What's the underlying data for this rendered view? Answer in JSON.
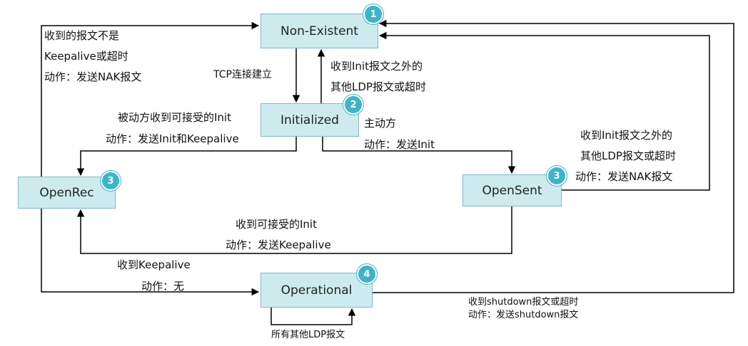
{
  "states": {
    "non_existent": {
      "label": "Non-Existent",
      "badge": "1"
    },
    "initialized": {
      "label": "Initialized",
      "badge": "2"
    },
    "openrec": {
      "label": "OpenRec",
      "badge": "3"
    },
    "opensent": {
      "label": "OpenSent",
      "badge": "3"
    },
    "operational": {
      "label": "Operational",
      "badge": "4"
    }
  },
  "transitions": {
    "left_top": {
      "line1": "收到的报文不是",
      "line2": "Keepalive或超时",
      "line3": "动作：发送NAK报文"
    },
    "tcp_connect": {
      "text": "TCP连接建立"
    },
    "init_fail": {
      "line1": "收到Init报文之外的",
      "line2": "其他LDP报文或超时"
    },
    "passive": {
      "line1": "被动方收到可接受的Init",
      "line2": "动作：发送Init和Keepalive"
    },
    "active": {
      "line1": "主动方",
      "line2": "动作：发送Init"
    },
    "opensent_fail": {
      "line1": "收到Init报文之外的",
      "line2": "其他LDP报文或超时",
      "line3": "动作：发送NAK报文"
    },
    "accept_init": {
      "line1": "收到可接受的Init",
      "line2": "动作：发送Keepalive"
    },
    "keepalive": {
      "line1": "收到Keepalive",
      "line2": "动作：无"
    },
    "shutdown": {
      "line1": "收到shutdown报文或超时",
      "line2": "动作：发送shutdown报文"
    },
    "self_loop": {
      "text": "所有其他LDP报文"
    }
  },
  "colors": {
    "state_fill": "#cdebef",
    "state_border": "#7fb8c4",
    "badge": "#3fb4c9",
    "line": "#000000"
  }
}
